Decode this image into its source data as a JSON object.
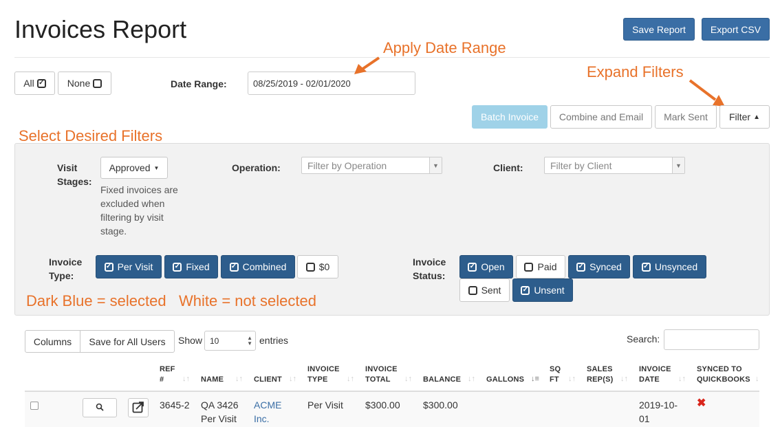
{
  "header": {
    "title": "Invoices Report",
    "save_report": "Save Report",
    "export_csv": "Export CSV"
  },
  "selection": {
    "all": "All",
    "none": "None"
  },
  "date_range": {
    "label": "Date Range:",
    "value": "08/25/2019 - 02/01/2020"
  },
  "actions": {
    "batch_invoice": "Batch Invoice",
    "combine_email": "Combine and Email",
    "mark_sent": "Mark Sent",
    "filter": "Filter"
  },
  "annotations": {
    "apply_date_range": "Apply Date Range",
    "expand_filters": "Expand Filters",
    "select_filters": "Select Desired Filters",
    "dark_blue": "Dark Blue = selected",
    "white": "White = not selected",
    "color": "#e8722a"
  },
  "filters": {
    "visit_stages": {
      "label_line1": "Visit",
      "label_line2": "Stages:",
      "value": "Approved",
      "hint": [
        "Fixed invoices are",
        "excluded when",
        "filtering by visit",
        "stage."
      ]
    },
    "operation": {
      "label": "Operation:",
      "placeholder": "Filter by Operation"
    },
    "client": {
      "label": "Client:",
      "placeholder": "Filter by Client"
    },
    "invoice_type": {
      "label_line1": "Invoice",
      "label_line2": "Type:",
      "options": [
        {
          "label": "Per Visit",
          "selected": true
        },
        {
          "label": "Fixed",
          "selected": true
        },
        {
          "label": "Combined",
          "selected": true
        },
        {
          "label": "$0",
          "selected": false
        }
      ]
    },
    "invoice_status": {
      "label_line1": "Invoice",
      "label_line2": "Status:",
      "options": [
        {
          "label": "Open",
          "selected": true
        },
        {
          "label": "Paid",
          "selected": false
        },
        {
          "label": "Synced",
          "selected": true
        },
        {
          "label": "Unsynced",
          "selected": true
        },
        {
          "label": "Sent",
          "selected": false
        },
        {
          "label": "Unsent",
          "selected": true
        }
      ]
    }
  },
  "table_controls": {
    "columns": "Columns",
    "save_all_users": "Save for All Users",
    "show": "Show",
    "entries_value": "10",
    "entries": "entries",
    "search": "Search:"
  },
  "table": {
    "headers": [
      [
        "REF",
        "#"
      ],
      [
        "NAME",
        ""
      ],
      [
        "CLIENT",
        ""
      ],
      [
        "INVOICE",
        "TYPE"
      ],
      [
        "INVOICE",
        "TOTAL"
      ],
      [
        "BALANCE",
        ""
      ],
      [
        "GALLONS",
        ""
      ],
      [
        "SQ",
        "FT"
      ],
      [
        "SALES",
        "REP(S)"
      ],
      [
        "INVOICE",
        "DATE"
      ],
      [
        "SYNCED TO",
        "QUICKBOOKS"
      ]
    ],
    "rows": [
      {
        "ref": "3645-2",
        "name": [
          "QA 3426",
          "Per Visit"
        ],
        "client": [
          "ACME",
          "Inc."
        ],
        "type": "Per Visit",
        "total": "$300.00",
        "balance": "$300.00",
        "date": [
          "2019-10-",
          "01"
        ],
        "synced": "✖"
      }
    ]
  },
  "colors": {
    "primary": "#3a6ea5",
    "selected": "#2d5d8c",
    "light": "#9fd2e8",
    "error": "#d9261c"
  }
}
